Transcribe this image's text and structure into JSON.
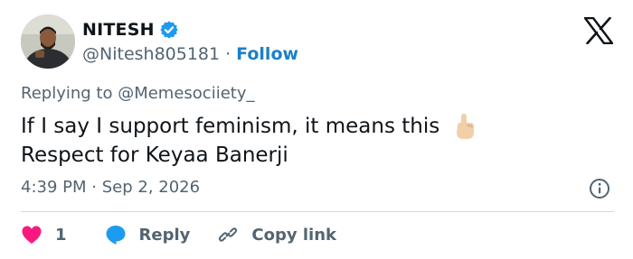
{
  "author": {
    "name": "NITESH",
    "handle": "@Nitesh805181",
    "separator": "·",
    "follow_label": "Follow"
  },
  "reply_context": {
    "prefix": "Replying to ",
    "mention": "@Memesociiety_"
  },
  "tweet": {
    "line1": "If I say I support feminism, it means this",
    "line2": "Respect for Keyaa Banerji"
  },
  "meta": {
    "time": "4:39 PM",
    "separator": "·",
    "date": "Sep 2, 2026"
  },
  "actions": {
    "like_count": "1",
    "reply_label": "Reply",
    "copy_link_label": "Copy link"
  },
  "colors": {
    "verified": "#1d9bf0",
    "follow": "#1d7fc9",
    "like": "#f91880",
    "reply_bubble": "#1d9bf0",
    "muted": "#536471",
    "text": "#0f1419"
  },
  "icons": {
    "verified": "verified-badge-icon",
    "x_logo": "x-logo-icon",
    "emoji": "pointing-up-hand-emoji",
    "info": "info-icon",
    "like": "heart-icon",
    "reply": "chat-bubble-icon",
    "copy_link": "link-icon"
  }
}
